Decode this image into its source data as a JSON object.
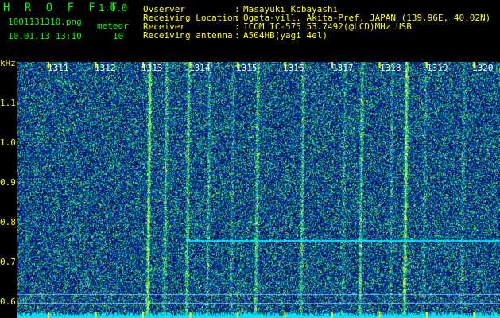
{
  "app": {
    "title": "H R O F F T",
    "version": "1.0.0",
    "filename": "1001131310.png",
    "datetime": "10.01.13 13:10",
    "counter_label": "meteor",
    "counter_value": "10"
  },
  "info": {
    "rows": [
      {
        "label": "Ovserver",
        "sep": ":",
        "value": "Masayuki Kobayashi"
      },
      {
        "label": "Receiving Location",
        "sep": ":",
        "value": "Ogata-vill. Akita-Pref. JAPAN (139.96E, 40.02N)"
      },
      {
        "label": "Receiver",
        "sep": ":",
        "value": "ICOM IC-575 53.7492(@LCD)MHz USB"
      },
      {
        "label": "Receiving antenna",
        "sep": ":",
        "value": "A504HB(yagi 4el)"
      }
    ]
  },
  "axis": {
    "unit": "kHz",
    "ticks": [
      "1.1",
      "1.0",
      "0.9",
      "0.8",
      "0.7",
      "0.6"
    ],
    "range_khz": [
      0.58,
      1.18
    ]
  },
  "timeline": {
    "minutes": [
      "1311",
      "1312",
      "1313",
      "1314",
      "1315",
      "1316",
      "1317",
      "1318",
      "1319",
      "1320"
    ]
  },
  "colors": {
    "background": "#00006e",
    "text_header": "#00ff00",
    "text_accent": "#ffff00",
    "axis_text": "#ffff00",
    "minute_text": "#ffffff",
    "tick_marker": "#ffff00",
    "steady_line": "#00e5ff",
    "noise_floor": "#00e5ff"
  }
}
